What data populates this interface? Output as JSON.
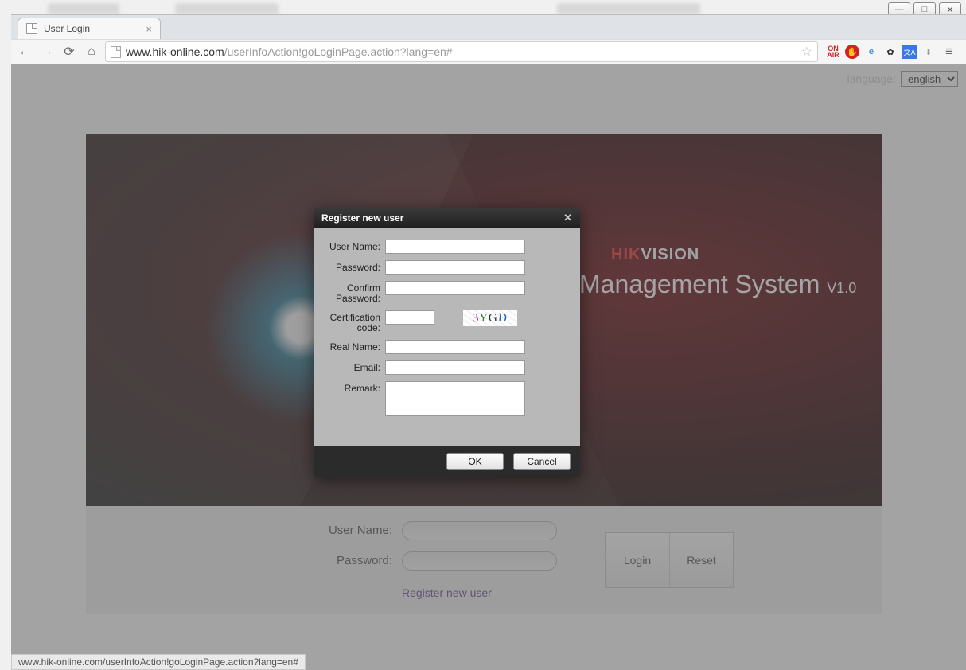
{
  "window": {
    "tab_title": "User Login"
  },
  "address": {
    "host": "www.hik-online.com",
    "path": "/userInfoAction!goLoginPage.action?lang=en#"
  },
  "language": {
    "label": "language:",
    "selected": "english"
  },
  "brand": {
    "hik": "HIK",
    "vision": "VISION",
    "system_name": "Management System",
    "version_prefix": "V",
    "version": "1.0"
  },
  "login": {
    "username_label": "User Name:",
    "password_label": "Password:",
    "register_link": "Register new user",
    "login_btn": "Login",
    "reset_btn": "Reset"
  },
  "modal": {
    "title": "Register new user",
    "fields": {
      "username": "User Name:",
      "password": "Password:",
      "confirm": "Confirm Password:",
      "cert": "Certification code:",
      "realname": "Real Name:",
      "email": "Email:",
      "remark": "Remark:"
    },
    "captcha": "3YGD",
    "ok": "OK",
    "cancel": "Cancel"
  },
  "statusbar": "www.hik-online.com/userInfoAction!goLoginPage.action?lang=en#"
}
